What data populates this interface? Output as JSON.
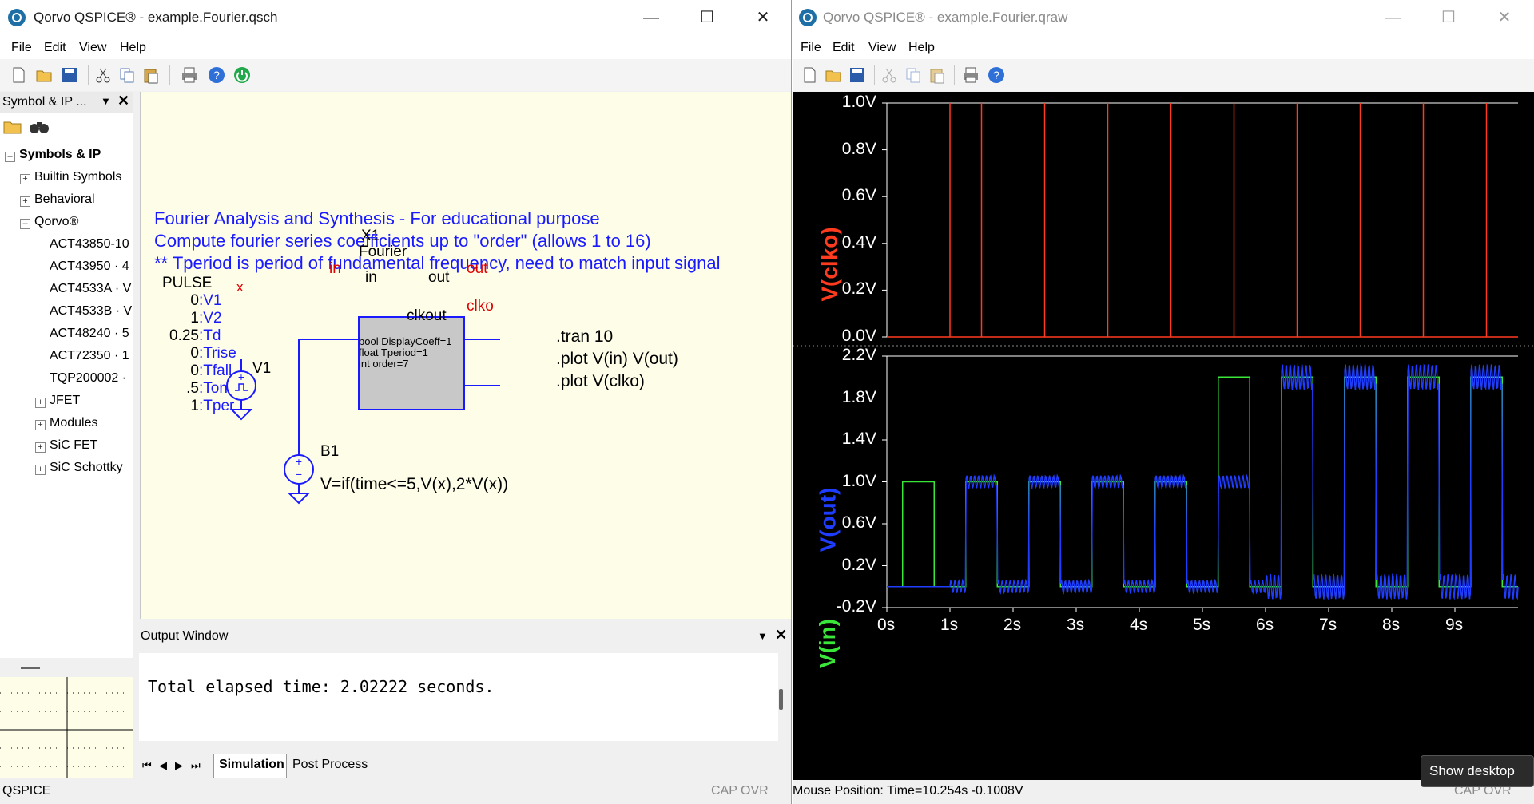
{
  "left_window": {
    "title": "Qorvo QSPICE® - example.Fourier.qsch",
    "menu": [
      "File",
      "Edit",
      "View",
      "Help"
    ],
    "dock_title": "Symbol & IP ...",
    "tree": {
      "root": "Symbols & IP",
      "items": [
        "Builtin Symbols",
        "Behavioral",
        "Qorvo®"
      ],
      "qorvo_children": [
        "ACT43850-10",
        "ACT43950 · 4",
        "ACT4533A · V",
        "ACT4533B · V",
        "ACT48240 · 5",
        "ACT72350 · 1",
        "TQP200002 ·"
      ],
      "more": [
        "JFET",
        "Modules",
        "SiC FET",
        "SiC Schottky"
      ]
    },
    "schematic": {
      "comment_lines": [
        "Fourier Analysis and Synthesis - For educational purpose",
        "Compute fourier series coefficients up to \"order\" (allows 1 to 16)",
        "** Tperiod is period of fundamental frequency, need to match input signal"
      ],
      "x1_name": "X1",
      "x1_type": "Fourier",
      "pin_in": "in",
      "pin_out": "out",
      "pin_clkout": "clkout",
      "net_in": "in",
      "net_out": "out",
      "net_clko": "clko",
      "net_x": "x",
      "params": [
        "bool DisplayCoeff=1",
        "float Tperiod=1",
        "int order=7"
      ],
      "pulse_title": "PULSE",
      "pulse_values": [
        "0",
        "1",
        "0.25",
        "0",
        "0",
        ".5",
        "1"
      ],
      "pulse_names": [
        ":V1",
        ":V2",
        ":Td",
        ":Trise",
        ":Tfall",
        ":Ton",
        ":Tper"
      ],
      "v1_label": "V1",
      "b1_label": "B1",
      "b1_expr": "V=if(time<=5,V(x),2*V(x))",
      "directives": [
        ".tran 10",
        ".plot V(in) V(out)",
        ".plot V(clko)"
      ]
    },
    "output_window": {
      "title": "Output Window",
      "text": "Total elapsed time: 2.02222 seconds."
    },
    "tabs": [
      "Simulation",
      "Post Process"
    ],
    "status_left": "QSPICE",
    "status_right": "CAP OVR"
  },
  "right_window": {
    "title": "Qorvo QSPICE® - example.Fourier.qraw",
    "menu": [
      "File",
      "Edit",
      "View",
      "Help"
    ],
    "status_left": "Mouse Position: Time=10.254s  -0.1008V",
    "status_right": "CAP OVR",
    "tooltip": "Show desktop"
  },
  "chart_data": [
    {
      "type": "line",
      "ylabel": "V(clko)",
      "ylim": [
        0,
        1
      ],
      "y_ticks": [
        "1.0V",
        "0.8V",
        "0.6V",
        "0.4V",
        "0.2V",
        "0.0V"
      ],
      "xlim": [
        0,
        10
      ],
      "series": [
        {
          "name": "V(clko)",
          "color": "#ff3b1f",
          "pulse_times": [
            1,
            2,
            3,
            4,
            5,
            6,
            7,
            8,
            9
          ],
          "pulse_times_offset": [
            0,
            0.5,
            0.5,
            0.5,
            0.5,
            0.5,
            0.5,
            0.5,
            0.5
          ],
          "edges_s": [
            1.0,
            1.5,
            2.5,
            3.5,
            4.5,
            5.5,
            6.5,
            7.5,
            8.5,
            9.5
          ]
        }
      ]
    },
    {
      "type": "line",
      "ylabel_series": [
        "V(out)",
        "V(in)"
      ],
      "ylim": [
        -0.2,
        2.2
      ],
      "y_ticks": [
        "2.2V",
        "1.8V",
        "1.4V",
        "1.0V",
        "0.6V",
        "0.2V",
        "-0.2V"
      ],
      "xlim": [
        0,
        10
      ],
      "x_ticks": [
        "0s",
        "1s",
        "2s",
        "3s",
        "4s",
        "5s",
        "6s",
        "7s",
        "8s",
        "9s"
      ],
      "series": [
        {
          "name": "V(in)",
          "color": "#39e639",
          "pulses": [
            [
              0.25,
              0.75,
              1
            ],
            [
              1.25,
              1.75,
              1
            ],
            [
              2.25,
              2.75,
              1
            ],
            [
              3.25,
              3.75,
              1
            ],
            [
              4.25,
              4.75,
              1
            ],
            [
              5.25,
              5.75,
              2
            ],
            [
              6.25,
              6.75,
              2
            ],
            [
              7.25,
              7.75,
              2
            ],
            [
              8.25,
              8.75,
              2
            ],
            [
              9.25,
              9.75,
              2
            ]
          ]
        },
        {
          "name": "V(out)",
          "color": "#1f3dff",
          "pulses": [
            [
              1.25,
              1.75,
              1
            ],
            [
              2.25,
              2.75,
              1
            ],
            [
              3.25,
              3.75,
              1
            ],
            [
              4.25,
              4.75,
              1
            ],
            [
              5.25,
              5.75,
              1
            ],
            [
              6.25,
              6.75,
              2
            ],
            [
              7.25,
              7.75,
              2
            ],
            [
              8.25,
              8.75,
              2
            ],
            [
              9.25,
              9.75,
              2
            ]
          ]
        }
      ]
    }
  ]
}
